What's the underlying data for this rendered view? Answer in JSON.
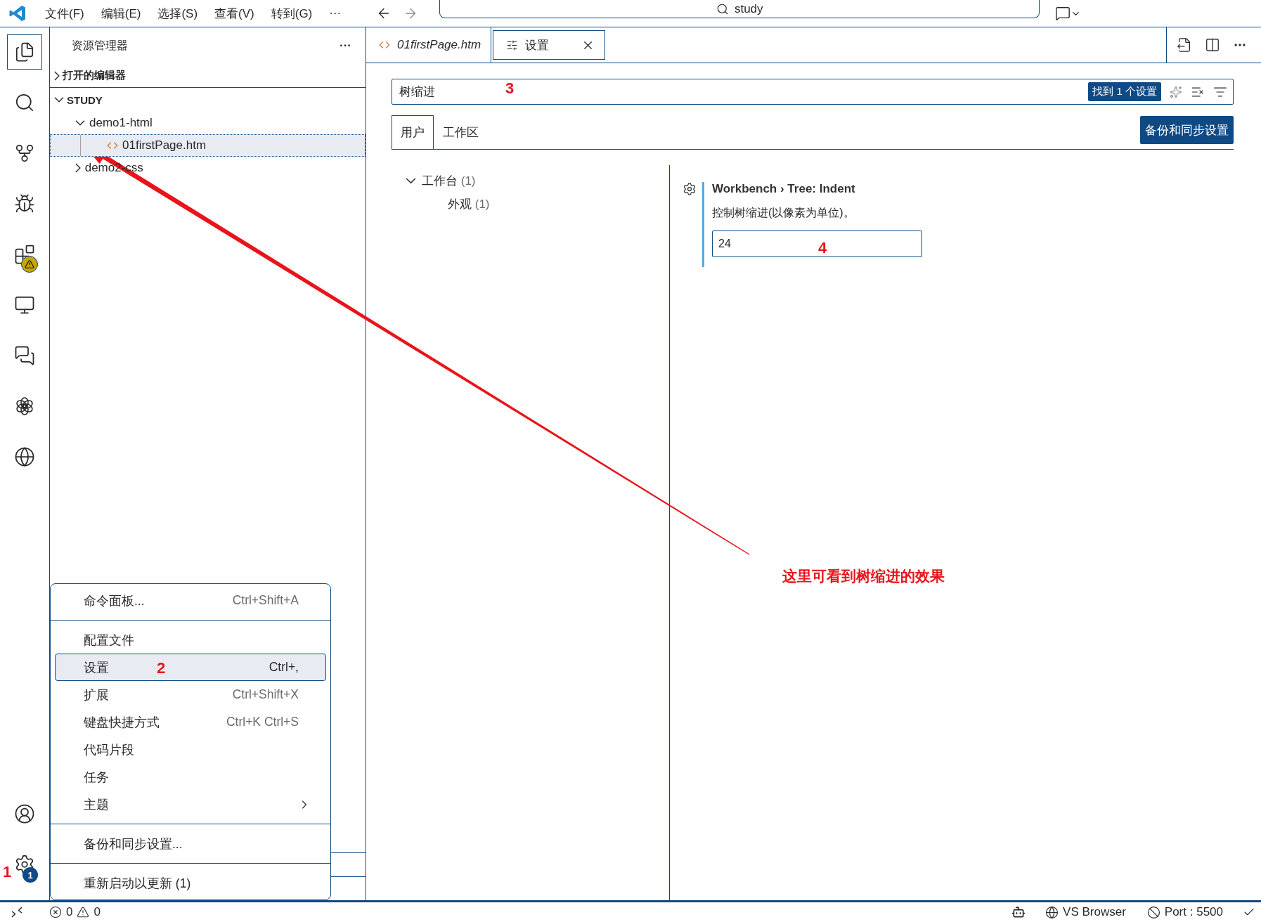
{
  "title_bar": {
    "menus": [
      "文件(F)",
      "编辑(E)",
      "选择(S)",
      "查看(V)",
      "转到(G)"
    ],
    "more": "···",
    "command_center": "study"
  },
  "activity_bar": {
    "items": [
      {
        "kind": "files",
        "selected": true
      },
      {
        "kind": "search",
        "selected": false
      },
      {
        "kind": "source-control",
        "selected": false
      },
      {
        "kind": "run-debug",
        "selected": false
      },
      {
        "kind": "extensions",
        "selected": false,
        "warning": true
      },
      {
        "kind": "remote",
        "selected": false
      },
      {
        "kind": "chat",
        "selected": false
      },
      {
        "kind": "knot",
        "selected": false
      },
      {
        "kind": "globe",
        "selected": false
      }
    ],
    "bottom": [
      {
        "kind": "account",
        "selected": false
      },
      {
        "kind": "manage",
        "selected": false,
        "badge": "1"
      }
    ]
  },
  "sidebar": {
    "title": "资源管理器",
    "more": "···",
    "sections": [
      {
        "label": "打开的编辑器",
        "expanded": false
      },
      {
        "label": "STUDY",
        "expanded": true,
        "children": [
          {
            "label": "demo1-html",
            "kind": "folder",
            "expanded": true,
            "selected": false,
            "children": [
              {
                "label": "01firstPage.htm",
                "kind": "file",
                "selected": true
              }
            ]
          },
          {
            "label": "demo2-css",
            "kind": "folder",
            "expanded": false,
            "selected": false
          }
        ]
      }
    ]
  },
  "editor": {
    "tabs": [
      {
        "label": "01firstPage.htm",
        "kind": "file",
        "preview": true,
        "selected": false
      },
      {
        "label": "设置",
        "kind": "settings",
        "preview": false,
        "selected": true
      }
    ]
  },
  "settings": {
    "search": {
      "value": "树缩进",
      "result": "找到 1 个设置"
    },
    "scope_tabs": [
      {
        "label": "用户",
        "selected": true
      },
      {
        "label": "工作区",
        "selected": false
      }
    ],
    "sync_button": "备份和同步设置",
    "toc": [
      {
        "label": "工作台",
        "count": "(1)",
        "expanded": true,
        "children": [
          {
            "label": "外观",
            "count": "(1)"
          }
        ]
      }
    ],
    "setting": {
      "title": "Workbench › Tree: **Indent**",
      "description": "控制树缩进(以像素为单位)。",
      "value": "24"
    }
  },
  "menu": {
    "items": [
      {
        "kind": "item",
        "label": "命令面板...",
        "shortcut": "Ctrl+Shift+A",
        "selected": false
      },
      {
        "kind": "separator"
      },
      {
        "kind": "item",
        "label": "配置文件",
        "selected": false
      },
      {
        "kind": "item",
        "label": "设置",
        "shortcut": "Ctrl+,",
        "selected": true
      },
      {
        "kind": "item",
        "label": "扩展",
        "shortcut": "Ctrl+Shift+X",
        "selected": false
      },
      {
        "kind": "item",
        "label": "键盘快捷方式",
        "shortcut": "Ctrl+K Ctrl+S",
        "selected": false
      },
      {
        "kind": "item",
        "label": "代码片段",
        "selected": false
      },
      {
        "kind": "item",
        "label": "任务",
        "selected": false
      },
      {
        "kind": "submenu",
        "label": "主题",
        "selected": false
      },
      {
        "kind": "separator"
      },
      {
        "kind": "item",
        "label": "备份和同步设置...",
        "selected": false
      },
      {
        "kind": "separator"
      },
      {
        "kind": "item",
        "label": "重新启动以更新 (1)",
        "selected": false
      }
    ]
  },
  "status_bar": {
    "errors": "0",
    "warnings": "0",
    "browser": "VS Browser",
    "port": "Port : 5500"
  },
  "annotations": {
    "markers": [
      "1",
      "2",
      "3",
      "4"
    ],
    "note": "这里可看到树缩进的效果"
  }
}
